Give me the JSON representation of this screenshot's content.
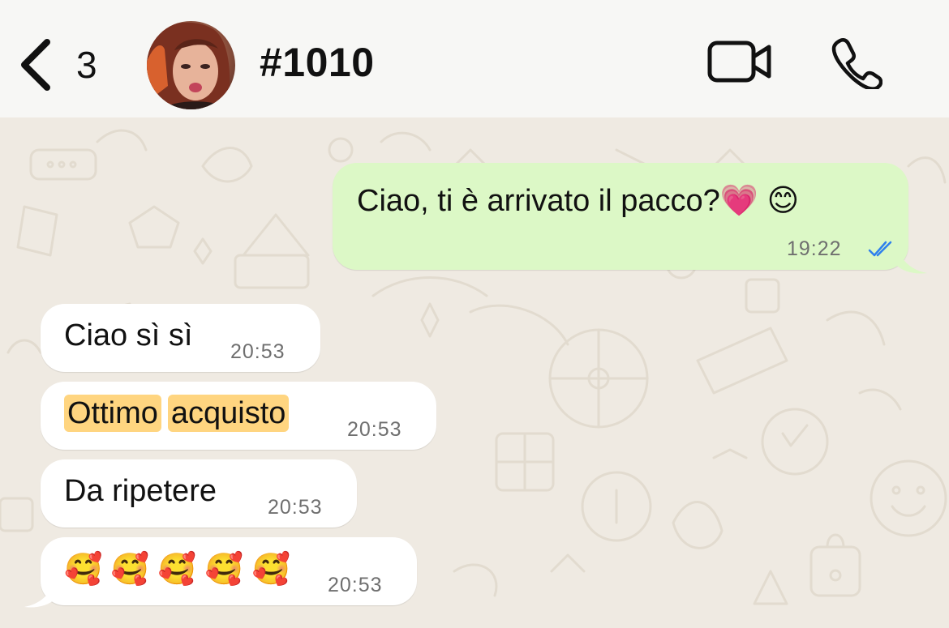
{
  "header": {
    "back_count": "3",
    "chat_title": "#1010"
  },
  "messages": [
    {
      "direction": "outgoing",
      "text": "Ciao, ti è arrivato il pacco?💗 😊",
      "time": "19:22",
      "status": "read"
    },
    {
      "direction": "incoming",
      "text": "Ciao sì sì",
      "time": "20:53"
    },
    {
      "direction": "incoming",
      "segments": [
        "Ottimo",
        "acquisto"
      ],
      "highlighted": true,
      "time": "20:53"
    },
    {
      "direction": "incoming",
      "text": "Da ripetere",
      "time": "20:53"
    },
    {
      "direction": "incoming",
      "text": "🥰 🥰 🥰 🥰 🥰",
      "time": "20:53"
    }
  ],
  "colors": {
    "header_bg": "#f7f7f5",
    "chat_bg": "#efeae2",
    "outgoing_bubble": "#dcf8c6",
    "incoming_bubble": "#ffffff",
    "highlight": "#ffd580",
    "read_ticks": "#2f80ed"
  },
  "icons": {
    "back": "chevron-left-icon",
    "video": "video-camera-icon",
    "call": "phone-icon",
    "read": "double-check-icon"
  }
}
